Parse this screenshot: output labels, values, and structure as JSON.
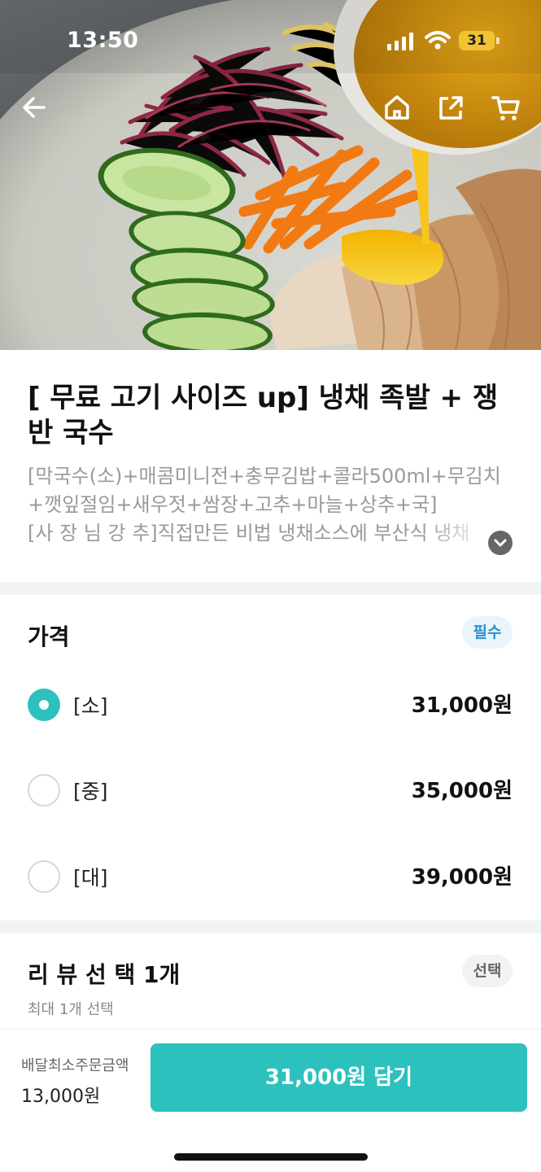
{
  "status_bar": {
    "time": "13:50",
    "battery_level": "31",
    "icons": [
      "signal-icon",
      "wifi-icon",
      "battery-icon"
    ]
  },
  "nav": {
    "icons": [
      "back-arrow-icon",
      "home-icon",
      "share-icon",
      "cart-icon"
    ]
  },
  "product": {
    "title": "[ 무료 고기 사이즈 up] 냉채 족발 + 쟁반 국수",
    "description_lines": [
      "[막국수(소)+매콤미니전+충무김밥+콜라500ml+무김치",
      "+깻잎절임+새우젓+쌈장+고추+마늘+상추+국]",
      "[사 장 님 강 추]직접만든 비법 냉채소스에 부산식 냉채"
    ]
  },
  "price_section": {
    "title": "가격",
    "badge": "필수",
    "options": [
      {
        "label": "[소]",
        "price": "31,000원",
        "selected": true
      },
      {
        "label": "[중]",
        "price": "35,000원",
        "selected": false
      },
      {
        "label": "[대]",
        "price": "39,000원",
        "selected": false
      }
    ]
  },
  "review_section": {
    "title": "리 뷰 선 택 1개",
    "badge": "선택",
    "subtitle": "최대 1개 선택"
  },
  "bottom_bar": {
    "min_order_label": "배달최소주문금액",
    "min_order_value": "13,000원",
    "add_button_label": "31,000원 담기"
  },
  "colors": {
    "accent": "#2cc1bd",
    "required_badge_bg": "#eaf5fb",
    "required_badge_text": "#2b8fcf",
    "divider": "#f2f3f5"
  }
}
